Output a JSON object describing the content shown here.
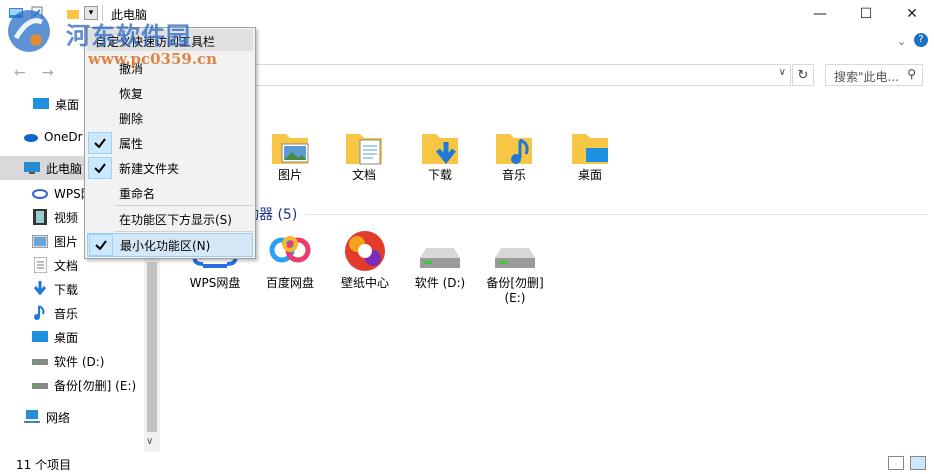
{
  "window": {
    "title": "此电脑",
    "minimize": "—",
    "maximize": "☐",
    "close": "✕"
  },
  "address": {
    "search_placeholder": "搜索\"此电..."
  },
  "qat_menu": {
    "title": "自定义快速访问工具栏",
    "items": [
      {
        "label": "撤消",
        "checked": false
      },
      {
        "label": "恢复",
        "checked": false
      },
      {
        "label": "删除",
        "checked": false
      },
      {
        "label": "属性",
        "checked": true
      },
      {
        "label": "新建文件夹",
        "checked": true
      },
      {
        "label": "重命名",
        "checked": false
      }
    ],
    "show_below": "在功能区下方显示(S)",
    "minimize_ribbon": "最小化功能区(N)",
    "minimize_ribbon_checked": true
  },
  "sidebar": {
    "items": [
      {
        "label": "桌面",
        "icon": "desktop-icon"
      },
      {
        "label": "OneDr",
        "icon": "onedrive-icon"
      },
      {
        "label": "此电脑",
        "icon": "computer-icon",
        "selected": true
      },
      {
        "label": "WPS网",
        "icon": "wps-cloud-icon"
      },
      {
        "label": "视频",
        "icon": "video-icon"
      },
      {
        "label": "图片",
        "icon": "picture-icon"
      },
      {
        "label": "文档",
        "icon": "document-icon"
      },
      {
        "label": "下载",
        "icon": "download-icon"
      },
      {
        "label": "音乐",
        "icon": "music-icon"
      },
      {
        "label": "桌面",
        "icon": "desktop-icon"
      },
      {
        "label": "软件 (D:)",
        "icon": "drive-icon"
      },
      {
        "label": "备份[勿删] (E:)",
        "icon": "drive-icon"
      },
      {
        "label": "网络",
        "icon": "network-icon"
      }
    ]
  },
  "folders": [
    {
      "label": "图片",
      "icon": "pictures-folder-icon"
    },
    {
      "label": "文档",
      "icon": "documents-folder-icon"
    },
    {
      "label": "下载",
      "icon": "downloads-folder-icon"
    },
    {
      "label": "音乐",
      "icon": "music-folder-icon"
    },
    {
      "label": "桌面",
      "icon": "desktop-folder-icon"
    }
  ],
  "devices": {
    "header": "动器 (5)",
    "items": [
      {
        "label": "WPS网盘",
        "icon": "wps-cloud-icon"
      },
      {
        "label": "百度网盘",
        "icon": "baidu-netdisk-icon"
      },
      {
        "label": "壁纸中心",
        "icon": "wallpaper-center-icon"
      },
      {
        "label": "软件 (D:)",
        "icon": "drive-icon"
      },
      {
        "label": "备份[勿删]\n(E:)",
        "icon": "drive-icon"
      }
    ]
  },
  "status": {
    "count": "11 个项目"
  },
  "watermark": {
    "line1": "河东软件园",
    "line2": "www.pc0359.cn"
  },
  "colors": {
    "menu_bg": "#f2f2f2",
    "check_bg": "#cce8ff",
    "folder_yellow": "#f6c644",
    "group_header": "#1e3287"
  }
}
